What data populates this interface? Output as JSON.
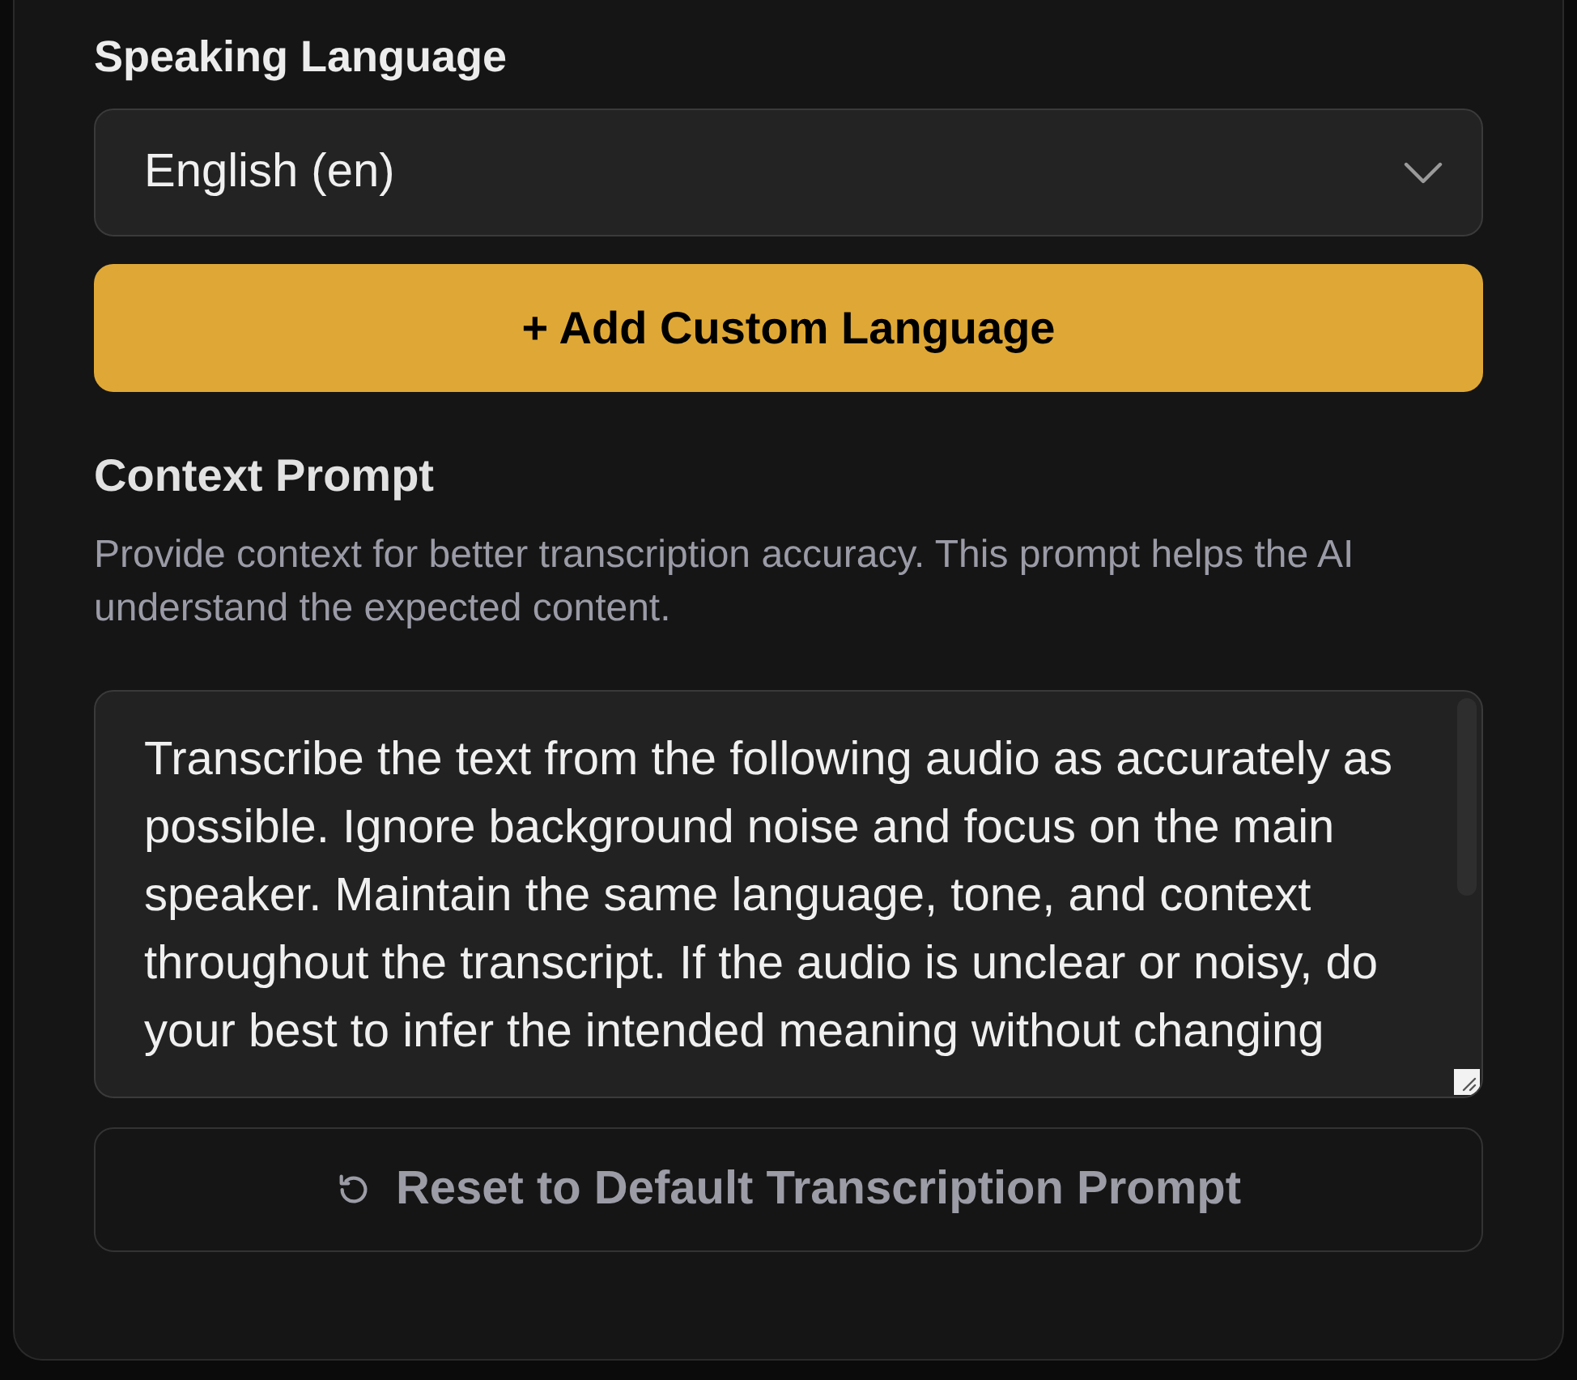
{
  "speaking_language": {
    "label": "Speaking Language",
    "select": {
      "value": "English (en)"
    }
  },
  "add_custom_language_button": {
    "label": "+ Add Custom Language"
  },
  "context_prompt": {
    "title": "Context Prompt",
    "description": "Provide context for better transcription accuracy. This prompt helps the AI understand the expected content.",
    "textarea": {
      "value": "Transcribe the text from the following audio as accurately as possible. Ignore background noise and focus on the main speaker. Maintain the same language, tone, and context throughout the transcript. If the audio is unclear or noisy, do your best to infer the intended meaning without changing"
    }
  },
  "reset_button": {
    "label": "Reset to Default Transcription Prompt"
  }
}
